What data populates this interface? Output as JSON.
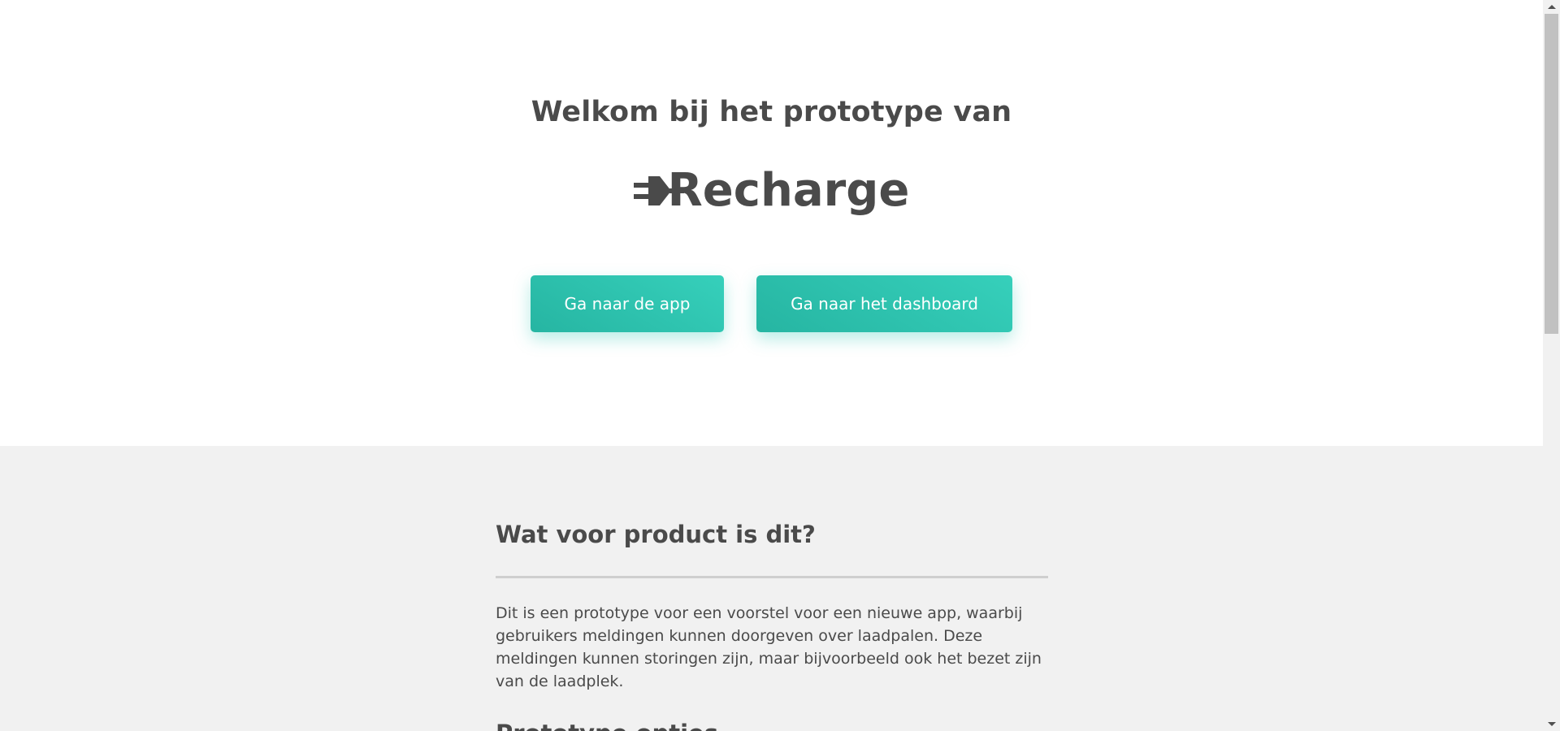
{
  "hero": {
    "intro": "Welkom bij het prototype van",
    "logo": {
      "text": "Recharge",
      "icon": "plug-icon"
    },
    "buttons": [
      {
        "label": "Ga naar de app"
      },
      {
        "label": "Ga naar het dashboard"
      }
    ]
  },
  "info": {
    "heading": "Wat voor product is dit?",
    "paragraph": "Dit is een prototype voor een voorstel voor een nieuwe app, waarbij gebruikers meldingen kunnen doorgeven over laadpalen. Deze meldingen kunnen storingen zijn, maar bijvoorbeeld ook het bezet zijn van de laadplek.",
    "next_heading": "Prototype opties"
  },
  "colors": {
    "accent": "#2fc4b1",
    "text": "#4a4a4a",
    "section_bg": "#f1f1f1"
  }
}
